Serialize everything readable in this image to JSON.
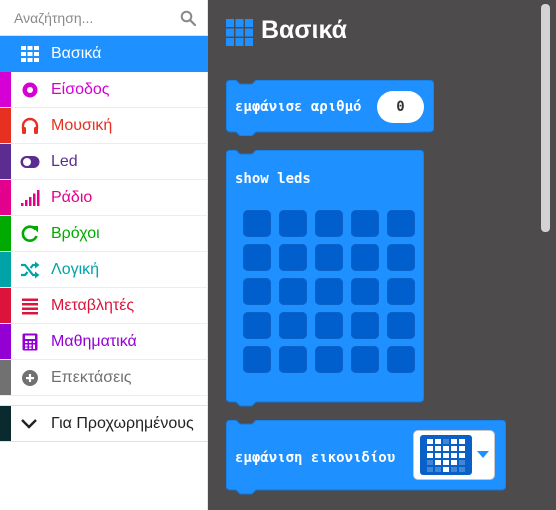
{
  "search": {
    "placeholder": "Αναζήτηση..."
  },
  "categories": [
    {
      "label": "Βασικά",
      "color": "#1e90ff",
      "icon": "grid-icon"
    },
    {
      "label": "Είσοδος",
      "color": "#d400d4",
      "icon": "target-icon"
    },
    {
      "label": "Μουσική",
      "color": "#e63022",
      "icon": "headphones-icon"
    },
    {
      "label": "Led",
      "color": "#5c2d91",
      "icon": "toggle-icon"
    },
    {
      "label": "Ράδιο",
      "color": "#e3008c",
      "icon": "signal-bars-icon"
    },
    {
      "label": "Βρόχοι",
      "color": "#00aa00",
      "icon": "refresh-icon"
    },
    {
      "label": "Λογική",
      "color": "#00a4a6",
      "icon": "shuffle-icon"
    },
    {
      "label": "Μεταβλητές",
      "color": "#dc143c",
      "icon": "list-icon"
    },
    {
      "label": "Μαθηματικά",
      "color": "#9400d3",
      "icon": "calculator-icon"
    },
    {
      "label": "Επεκτάσεις",
      "color": "#717171",
      "icon": "plus-circle-icon"
    }
  ],
  "advanced": {
    "label": "Για Προχωρημένους",
    "icon": "chevron-down-icon"
  },
  "flyout": {
    "title": "Βασικά",
    "block_color": "#1e90ff",
    "show_number": {
      "label": "εμφάνισε αριθμό",
      "value": "0"
    },
    "show_leds": {
      "label": "show leds"
    },
    "show_icon": {
      "label": "εμφάνιση εικονιδίου",
      "selected_icon": "heart-icon"
    }
  }
}
